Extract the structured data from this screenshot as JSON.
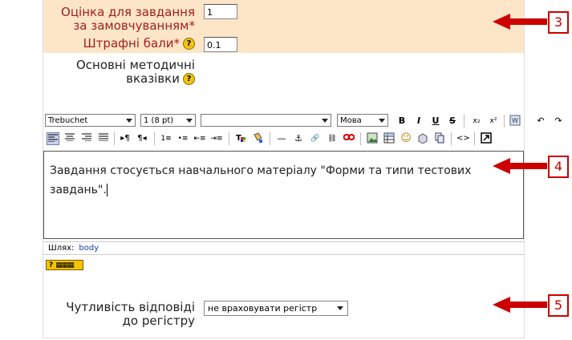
{
  "form": {
    "score": {
      "label_line1": "Оцінка для завдання",
      "label_line2": "за замовчуванням*",
      "value": "1"
    },
    "penalty": {
      "label": "Штрафні бали*",
      "value": "0.1"
    },
    "guidelines": {
      "label_line1": "Основні методичні",
      "label_line2": "вказівки"
    },
    "case": {
      "label_line1": "Чутливість відповіді",
      "label_line2": "до регістру",
      "selected": "не враховувати регістр"
    }
  },
  "toolbar": {
    "font": "Trebuchet",
    "size": "1 (8 pt)",
    "style": "",
    "lang": "Мова",
    "bold": "B",
    "italic": "I",
    "underline": "U",
    "strike": "S",
    "sub": "x₂",
    "sup": "x²",
    "undo": "↶",
    "redo": "↷",
    "hr": "—",
    "anchor": "⚓",
    "link": "🔗",
    "unlink": "⛓",
    "smiley": "☺",
    "code": "<>"
  },
  "editor": {
    "text": "Завдання стосується навчального матеріалу \"Форми та типи тестових завдань\"."
  },
  "path": {
    "label": "Шлях:",
    "value": "body"
  },
  "help_glyph": "?",
  "callouts": [
    "3",
    "4",
    "5"
  ],
  "colors": {
    "accent_red": "#cc0000",
    "highlight": "#fde6c7",
    "label_red": "#a21e1e"
  }
}
